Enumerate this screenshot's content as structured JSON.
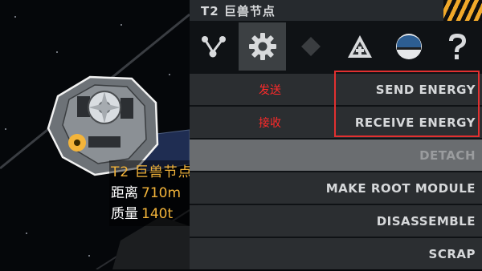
{
  "world_tag": {
    "name": "T2 巨兽节点",
    "distance_label": "距离",
    "distance_value": "710m",
    "mass_label": "质量",
    "mass_value": "140t"
  },
  "panel": {
    "title": "T2 巨兽节点",
    "tabs": [
      {
        "icon": "node-graph-icon",
        "active": false
      },
      {
        "icon": "gear-icon",
        "active": true
      },
      {
        "icon": "diamond-icon",
        "active": false
      },
      {
        "icon": "medical-tent-icon",
        "active": false
      },
      {
        "icon": "helmet-icon",
        "active": false
      },
      {
        "icon": "question-mark-icon",
        "active": false
      }
    ],
    "menu": [
      {
        "label": "SEND ENERGY",
        "annotation": "发送"
      },
      {
        "label": "RECEIVE ENERGY",
        "annotation": "接收"
      },
      {
        "label": "DETACH",
        "annotation": ""
      },
      {
        "label": "MAKE ROOT MODULE",
        "annotation": ""
      },
      {
        "label": "DISASSEMBLE",
        "annotation": ""
      },
      {
        "label": "SCRAP",
        "annotation": ""
      }
    ]
  },
  "colors": {
    "accent_yellow": "#f3b43a",
    "annotation_red": "#ff2a2a",
    "highlight_box": "#e23030"
  }
}
